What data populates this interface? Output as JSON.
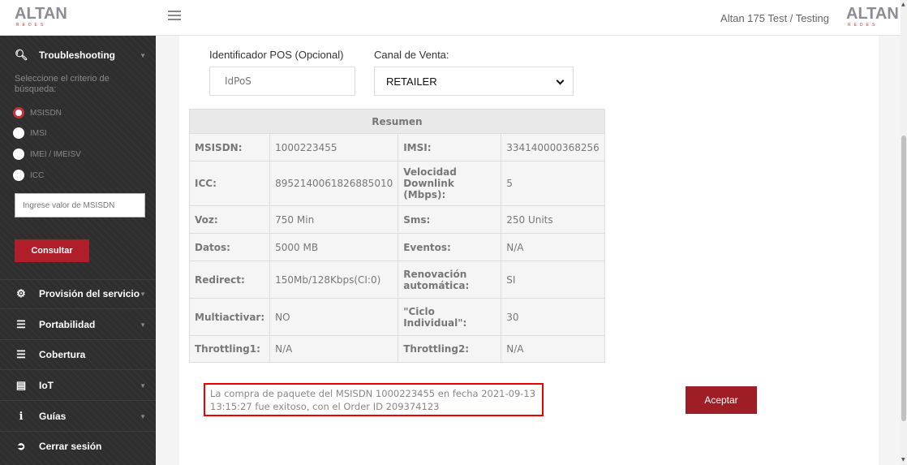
{
  "header": {
    "logo_text": "ALTAN",
    "logo_sub": "REDES",
    "user_label": "Altan 175 Test / Testing"
  },
  "sidebar": {
    "troubleshooting": "Troubleshooting",
    "criteria_label": "Seleccione el criterio de búsqueda:",
    "options": [
      "MSISDN",
      "IMSI",
      "IMEI / IMEISV",
      "ICC"
    ],
    "selected_option": "MSISDN",
    "input_placeholder": "Ingrese valor de MSISDN",
    "consultar": "Consultar",
    "menu": [
      {
        "label": "Provisión del servicio",
        "icon": "gears-icon"
      },
      {
        "label": "Portabilidad",
        "icon": "sliders-icon"
      },
      {
        "label": "Cobertura",
        "icon": "sliders-icon"
      },
      {
        "label": "IoT",
        "icon": "document-icon"
      },
      {
        "label": "Guías",
        "icon": "info-icon"
      },
      {
        "label": "Cerrar sesión",
        "icon": "logout-icon"
      }
    ]
  },
  "form": {
    "pos_label": "Identificador POS (Opcional)",
    "pos_placeholder": "IdPoS",
    "canal_label": "Canal de Venta:",
    "canal_value": "RETAILER"
  },
  "summary": {
    "title": "Resumen",
    "rows": [
      [
        "MSISDN:",
        "1000223455",
        "IMSI:",
        "334140000368256"
      ],
      [
        "ICC:",
        "8952140061826885010",
        "Velocidad Downlink (Mbps):",
        "5"
      ],
      [
        "Voz:",
        "750 Min",
        "Sms:",
        "250 Units"
      ],
      [
        "Datos:",
        "5000 MB",
        "Eventos:",
        "N/A"
      ],
      [
        "Redirect:",
        "150Mb/128Kbps(CI:0)",
        "Renovación automática:",
        "SI"
      ],
      [
        "Multiactivar:",
        "NO",
        "\"Ciclo Individual\":",
        "30"
      ],
      [
        "Throttling1:",
        "N/A",
        "Throttling2:",
        "N/A"
      ]
    ]
  },
  "message": "La compra de paquete del MSISDN 1000223455 en fecha 2021-09-13 13:15:27 fue exitoso, con el Order ID 209374123",
  "aceptar": "Aceptar",
  "colors": {
    "accent": "#b01e2a",
    "sidebar": "#2e2e2e",
    "alert_border": "#e00000"
  }
}
